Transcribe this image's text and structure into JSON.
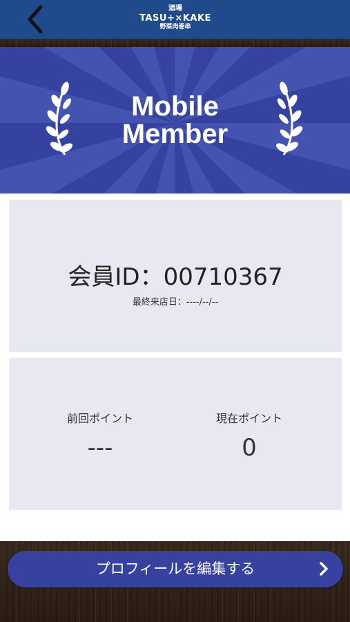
{
  "header": {
    "logo_line1": "酒場",
    "logo_line2": "TASU+×KAKE",
    "logo_line3": "野菜肉巻串",
    "back_icon": "chevron-left-icon"
  },
  "banner": {
    "title_line1": "Mobile",
    "title_line2": "Member",
    "decoration_icon": "laurel-icon",
    "colors": {
      "background": "#3642a0",
      "rays": "#4553b0"
    }
  },
  "member": {
    "id_text": "会員ID：00710367",
    "last_visit_text": "最終来店日：----/--/--"
  },
  "points": {
    "previous_label": "前回ポイント",
    "previous_value": "---",
    "current_label": "現在ポイント",
    "current_value": "0"
  },
  "footer": {
    "edit_profile_label": "プロフィールを編集する",
    "chevron_icon": "chevron-right-icon",
    "button_color": "#3641a0"
  },
  "colors": {
    "header": "#1f4a8c",
    "card": "#e8e8f3",
    "wood": "#2e2119"
  }
}
